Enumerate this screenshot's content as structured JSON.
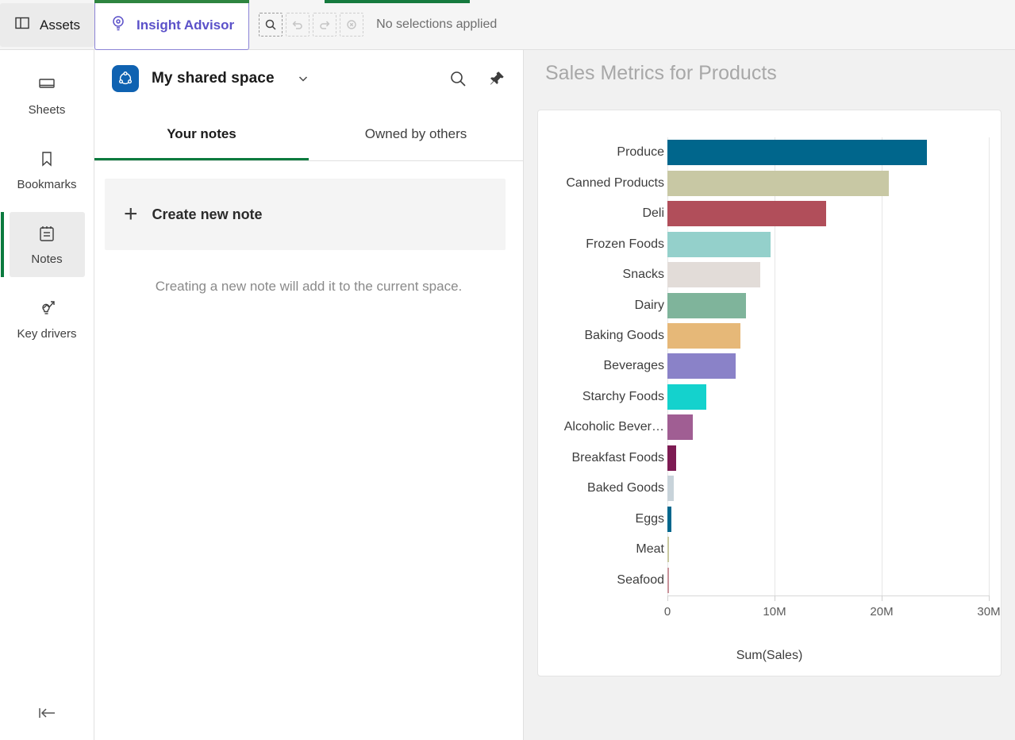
{
  "topbar": {
    "assets_label": "Assets",
    "insight_advisor_label": "Insight Advisor",
    "selections_text": "No selections applied",
    "icons": {
      "assets": "panel-icon",
      "insight": "lightbulb-search-icon",
      "selection_search": "selection-search-icon",
      "undo": "undo-icon",
      "redo": "redo-icon",
      "clear": "clear-selections-icon"
    }
  },
  "rail": {
    "items": [
      {
        "label": "Sheets",
        "icon": "sheets-icon",
        "active": false
      },
      {
        "label": "Bookmarks",
        "icon": "bookmark-icon",
        "active": false
      },
      {
        "label": "Notes",
        "icon": "notes-icon",
        "active": true
      },
      {
        "label": "Key drivers",
        "icon": "key-drivers-icon",
        "active": false
      }
    ],
    "collapse_icon": "collapse-left-icon"
  },
  "notes": {
    "space_name": "My shared space",
    "space_icon": "shared-space-icon",
    "caret_icon": "chevron-down-icon",
    "search_icon": "search-icon",
    "pin_icon": "pin-icon",
    "tabs": [
      {
        "label": "Your notes",
        "active": true
      },
      {
        "label": "Owned by others",
        "active": false
      }
    ],
    "create_label": "Create new note",
    "create_icon": "plus-icon",
    "hint": "Creating a new note will add it to the current space."
  },
  "chart_panel": {
    "title": "Sales Metrics for Products"
  },
  "chart_data": {
    "type": "bar",
    "orientation": "horizontal",
    "title": "Sales Metrics for Products",
    "xlabel": "Sum(Sales)",
    "ylabel": "",
    "xlim": [
      0,
      30000000
    ],
    "xticks": [
      0,
      10000000,
      20000000,
      30000000
    ],
    "xtick_labels": [
      "0",
      "10M",
      "20M",
      "30M"
    ],
    "grid": true,
    "legend": "none",
    "categories": [
      "Produce",
      "Canned Products",
      "Deli",
      "Frozen Foods",
      "Snacks",
      "Dairy",
      "Baking Goods",
      "Beverages",
      "Starchy Foods",
      "Alcoholic Bever…",
      "Breakfast Foods",
      "Baked Goods",
      "Eggs",
      "Meat",
      "Seafood"
    ],
    "values": [
      24200000,
      20700000,
      14800000,
      9600000,
      8700000,
      7300000,
      6800000,
      6400000,
      3600000,
      2400000,
      800000,
      600000,
      350000,
      150000,
      120000
    ],
    "colors": [
      "#00668c",
      "#c8c8a4",
      "#b14e5a",
      "#94d0cb",
      "#e2dcd8",
      "#7fb49b",
      "#e6b878",
      "#8a82c8",
      "#14d2cd",
      "#a05e93",
      "#7d1b53",
      "#c8d3da",
      "#00678d",
      "#c8c8a0",
      "#c9929a"
    ]
  }
}
